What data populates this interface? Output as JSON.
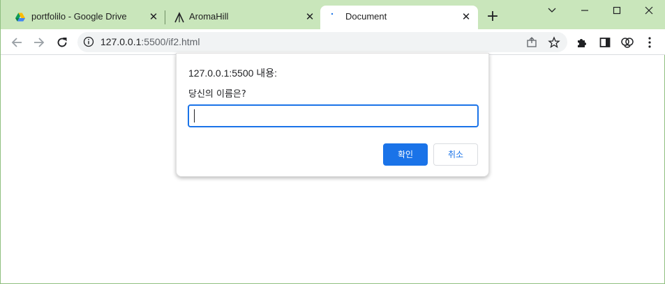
{
  "tabs": [
    {
      "title": "portfolilo - Google Drive",
      "icon": "google-drive-icon",
      "active": false
    },
    {
      "title": "AromaHill",
      "icon": "aromahill-logo-icon",
      "active": false
    },
    {
      "title": "Document",
      "icon": "loading-icon",
      "active": true
    }
  ],
  "tab_close_glyph": "✕",
  "new_tab_glyph": "+",
  "window_controls": {
    "dropdown": "⌄",
    "minimize": "—",
    "maximize": "☐",
    "close": "✕"
  },
  "address_bar": {
    "host": "127.0.0.1",
    "path": ":5500/if2.html"
  },
  "dialog": {
    "origin_text": "127.0.0.1:5500 내용:",
    "message": "당신의 이름은?",
    "input_value": "",
    "ok_label": "확인",
    "cancel_label": "취소"
  },
  "colors": {
    "tabstrip": "#c9e6bb",
    "accent": "#1a73e8"
  }
}
